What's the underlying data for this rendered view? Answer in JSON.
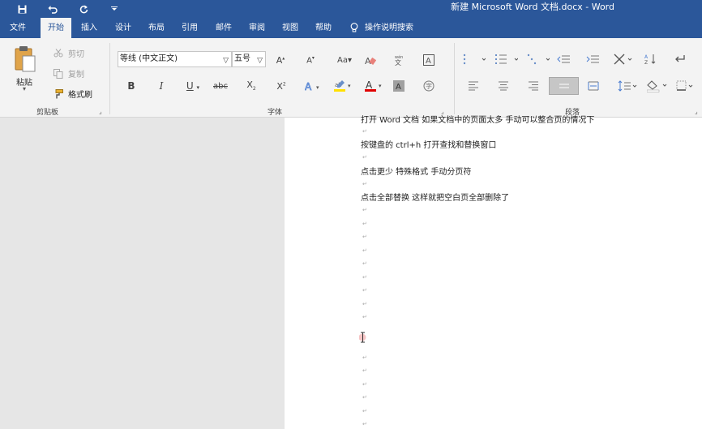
{
  "title_bar": {
    "title": "新建 Microsoft Word 文档.docx  -  Word",
    "bg_color": "#2b579a"
  },
  "qat": [
    {
      "name": "save-icon",
      "glyph": "💾"
    },
    {
      "name": "undo-icon",
      "glyph": "↶"
    },
    {
      "name": "redo-icon",
      "glyph": "↻"
    },
    {
      "name": "customize-qat-icon",
      "glyph": "⏷"
    }
  ],
  "tabs": [
    {
      "label": "文件"
    },
    {
      "label": "开始"
    },
    {
      "label": "插入"
    },
    {
      "label": "设计"
    },
    {
      "label": "布局"
    },
    {
      "label": "引用"
    },
    {
      "label": "邮件"
    },
    {
      "label": "审阅"
    },
    {
      "label": "视图"
    },
    {
      "label": "帮助"
    }
  ],
  "active_tab": "开始",
  "tell_me": {
    "label": "操作说明搜索",
    "icon": "lightbulb-icon"
  },
  "clipboard": {
    "paste_label": "粘贴",
    "cut_label": "剪切",
    "copy_label": "复制",
    "format_painter_label": "格式刷",
    "group_label": "剪贴板"
  },
  "font": {
    "font_name": "等线 (中文正文)",
    "font_size": "五号",
    "group_label": "字体",
    "highlight_color": "#ffe000",
    "font_color": "#e00000"
  },
  "paragraph": {
    "group_label": "段落"
  },
  "document": {
    "lines": [
      "打开 Word 文档  如果文档中的页面太多  手动可以整合页的情况下",
      "按键盘的 ctrl+h 打开查找和替换窗口",
      "点击更少  特殊格式  手动分页符",
      "点击全部替换  这样就把空白页全部删除了"
    ]
  }
}
